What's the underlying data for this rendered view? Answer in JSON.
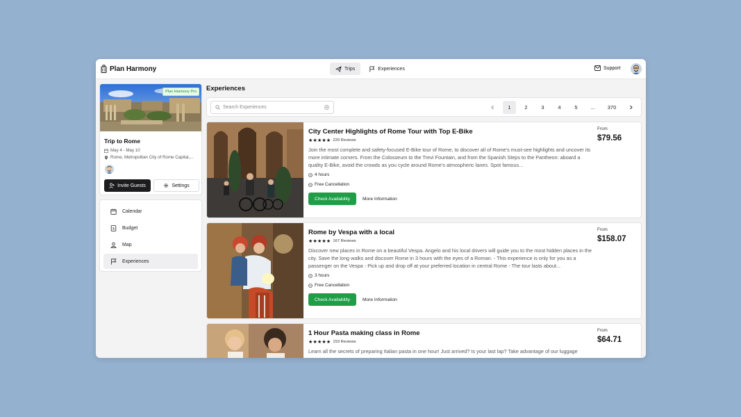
{
  "app": {
    "name": "Plan Harmony"
  },
  "nav": {
    "trips": "Trips",
    "experiences": "Experiences"
  },
  "support": "Support",
  "trip": {
    "badge": "Plan Harmony Pro",
    "title": "Trip to Rome",
    "dates": "May 4 - May 10",
    "location": "Rome, Metropolitan City of Rome Capital,...",
    "invite": "Invite Guests",
    "settings": "Settings"
  },
  "menu": [
    "Calendar",
    "Budget",
    "Map",
    "Experiences"
  ],
  "section_title": "Experiences",
  "search": {
    "placeholder": "Search Experiences"
  },
  "pagination": {
    "pages": [
      "1",
      "2",
      "3",
      "4",
      "5"
    ],
    "ellipsis": "...",
    "last": "370",
    "current": "1"
  },
  "labels": {
    "from": "From",
    "check": "Check Availability",
    "more": "More Information",
    "free_cancel": "Free Cancellation"
  },
  "experiences": [
    {
      "title": "City Center Highlights of Rome Tour with Top E-Bike",
      "stars": "★★★★★",
      "reviews": "220 Reviews",
      "description": "Join the most complete and safety-focused E-Bike tour of Rome, to discover all of Rome's must-see highlights and uncover its more intimate corners. From the Colosseum to the Trevi Fountain, and from the Spanish Steps to the Pantheon: aboard a quality E-Bike, avoid the crowds as you cycle around Rome's atmospheric lanes. Spot famous...",
      "duration": "4 hours",
      "price": "$79.56"
    },
    {
      "title": "Rome by Vespa with a local",
      "stars": "★★★★★",
      "reviews": "167 Reviews",
      "description": "Discover new places in Rome on a beautiful Vespa. Angelo and his local drivers will guide you to the most hidden places in the city. Save the long walks and discover Rome in 3 hours with the eyes of a Roman. - This experience is only for you as a passenger on the Vespa - Pick up and drop off at your preferred location in central Rome - The tour lasts about...",
      "duration": "3 hours",
      "price": "$158.07"
    },
    {
      "title": "1 Hour Pasta making class in Rome",
      "stars": "★★★★★",
      "reviews": "153 Reviews",
      "description": "Learn all the secrets of preparing Italian pasta in one hour! Just arrived? Is your last lap? Take advantage of our luggage",
      "price": "$64.71"
    }
  ]
}
